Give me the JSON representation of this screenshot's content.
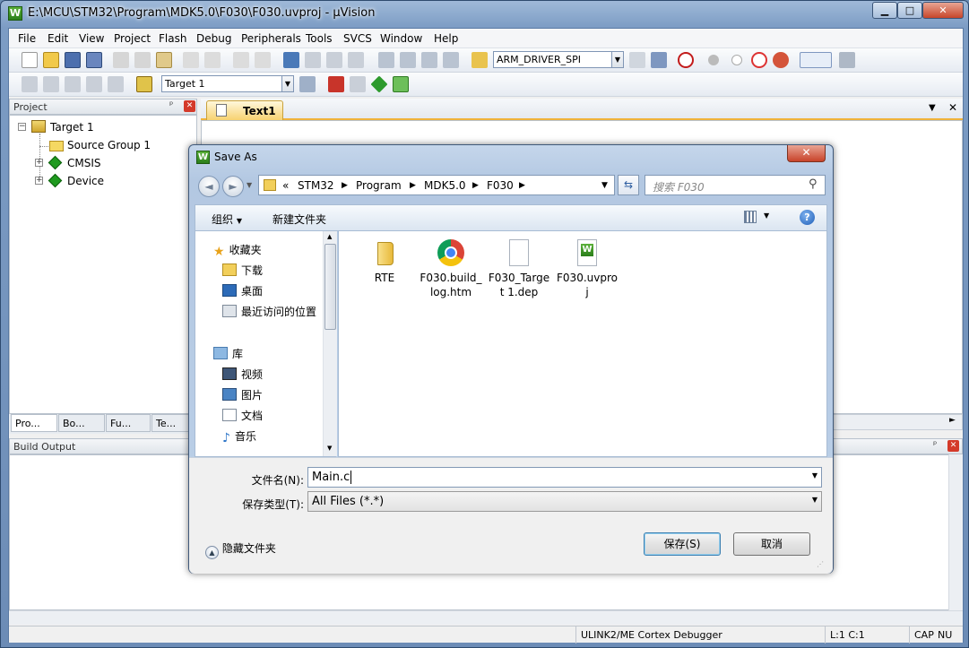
{
  "window": {
    "title": "E:\\MCU\\STM32\\Program\\MDK5.0\\F030\\F030.uvproj - µVision",
    "app_icon": "W",
    "controls": {
      "minimize": "▁",
      "maximize": "□",
      "close": "✕"
    }
  },
  "menu": [
    "File",
    "Edit",
    "View",
    "Project",
    "Flash",
    "Debug",
    "Peripherals",
    "Tools",
    "SVCS",
    "Window",
    "Help"
  ],
  "toolbar": {
    "driver_select": "ARM_DRIVER_SPI",
    "target_select": "Target 1"
  },
  "project_panel": {
    "title": "Project",
    "pin": "ᵖ",
    "close": "✕",
    "tree": {
      "root": "Target 1",
      "children": [
        {
          "label": "Source Group 1"
        },
        {
          "label": "CMSIS"
        },
        {
          "label": "Device"
        }
      ]
    },
    "bottom_tabs": [
      "Pro...",
      "Bo...",
      "Fu...",
      "Te..."
    ]
  },
  "editor": {
    "active_tab": "Text1",
    "dropdown": "▼",
    "close": "✕"
  },
  "build_output": {
    "title": "Build Output"
  },
  "statusbar": {
    "debugger": "ULINK2/ME Cortex Debugger",
    "position": "L:1 C:1",
    "caps": "CAP",
    "num": "NU"
  },
  "dialog": {
    "title": "Save As",
    "close": "✕",
    "breadcrumb": [
      "«",
      "STM32",
      "Program",
      "MDK5.0",
      "F030"
    ],
    "search_placeholder": "搜索 F030",
    "organize": "组织",
    "new_folder": "新建文件夹",
    "help": "?",
    "nav": {
      "favorites": "收藏夹",
      "favorites_items": [
        "下载",
        "桌面",
        "最近访问的位置"
      ],
      "libraries": "库",
      "library_items": [
        "视频",
        "图片",
        "文档",
        "音乐"
      ]
    },
    "files": [
      {
        "name": "RTE",
        "type": "folder"
      },
      {
        "name": "F030.build_log.htm",
        "type": "chrome"
      },
      {
        "name": "F030_Target 1.dep",
        "type": "file"
      },
      {
        "name": "F030.uvproj",
        "type": "uvision"
      }
    ],
    "filename_label": "文件名(N):",
    "filename_value": "Main.c",
    "filetype_label": "保存类型(T):",
    "filetype_value": "All Files (*.*)",
    "hide_folders": "隐藏文件夹",
    "save_button": "保存(S)",
    "cancel_button": "取消"
  }
}
